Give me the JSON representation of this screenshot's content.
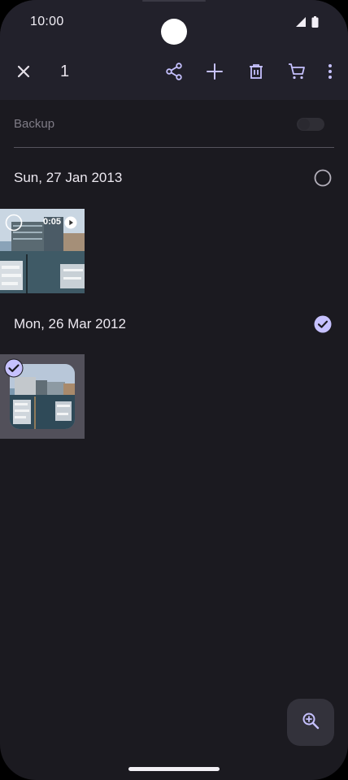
{
  "status_bar": {
    "time": "10:00",
    "icons": [
      "signal-icon",
      "battery-icon"
    ]
  },
  "action_bar": {
    "selected_count": "1",
    "icons": [
      "close-icon",
      "share-icon",
      "add-icon",
      "delete-icon",
      "cart-icon",
      "more-vert-icon"
    ],
    "accent_color": "#c6c1ff"
  },
  "backup": {
    "label": "Backup",
    "enabled": false
  },
  "groups": [
    {
      "date": "Sun, 27 Jan 2013",
      "selected": false,
      "items": [
        {
          "type": "video",
          "duration": "0:05",
          "selected": false
        }
      ]
    },
    {
      "date": "Mon, 26 Mar 2012",
      "selected": true,
      "items": [
        {
          "type": "photo",
          "selected": true
        }
      ]
    }
  ],
  "fab": {
    "icon": "zoom-in-icon"
  }
}
